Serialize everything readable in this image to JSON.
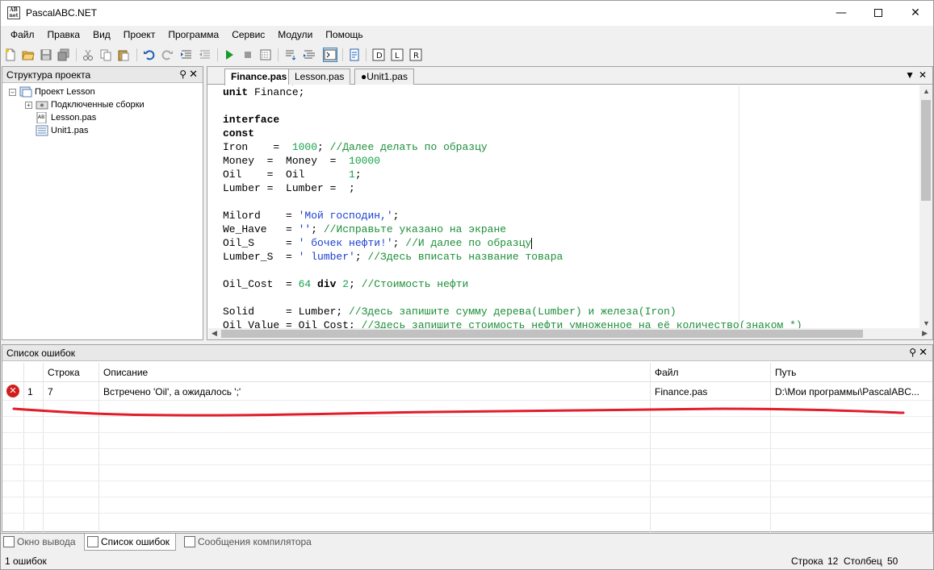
{
  "window": {
    "title": "PascalABC.NET",
    "icon_text": "AB net"
  },
  "menu": [
    "Файл",
    "Правка",
    "Вид",
    "Проект",
    "Программа",
    "Сервис",
    "Модули",
    "Помощь"
  ],
  "project_panel": {
    "title": "Структура проекта",
    "tree": [
      {
        "label": "Проект Lesson",
        "level": 0,
        "expanded": true
      },
      {
        "label": "Подключенные сборки",
        "level": 1,
        "expanded": false
      },
      {
        "label": "Lesson.pas",
        "level": 1
      },
      {
        "label": "Unit1.pas",
        "level": 1
      }
    ]
  },
  "editor": {
    "tabs": [
      {
        "label": "Finance.pas",
        "active": true
      },
      {
        "label": "Lesson.pas",
        "active": false
      },
      {
        "label": "●Unit1.pas",
        "active": false
      }
    ],
    "code_lines": [
      [
        [
          "kw",
          "unit"
        ],
        [
          "ident",
          " Finance;"
        ]
      ],
      [],
      [
        [
          "kw",
          "interface"
        ]
      ],
      [
        [
          "kw",
          "const"
        ]
      ],
      [
        [
          "ident",
          "Iron    =  "
        ],
        [
          "num",
          "1000"
        ],
        [
          "ident",
          "; "
        ],
        [
          "cmt",
          "//Далее делать по образцу"
        ]
      ],
      [
        [
          "ident",
          "Money  =  Money  =  "
        ],
        [
          "num",
          "10000"
        ]
      ],
      [
        [
          "ident",
          "Oil    =  Oil       "
        ],
        [
          "num",
          "1"
        ],
        [
          "ident",
          ";"
        ]
      ],
      [
        [
          "ident",
          "Lumber =  Lumber =  ;"
        ]
      ],
      [],
      [
        [
          "ident",
          "Milord    = "
        ],
        [
          "str",
          "'Мой господин,'"
        ],
        [
          "ident",
          ";"
        ]
      ],
      [
        [
          "ident",
          "We_Have   = "
        ],
        [
          "str",
          "''"
        ],
        [
          "ident",
          "; "
        ],
        [
          "cmt",
          "//Исправьте указано на экране"
        ]
      ],
      [
        [
          "ident",
          "Oil_S     = "
        ],
        [
          "str",
          "' бочек нефти!'"
        ],
        [
          "ident",
          "; "
        ],
        [
          "cmt",
          "//И далее по образцу"
        ],
        [
          "caret",
          ""
        ]
      ],
      [
        [
          "ident",
          "Lumber_S  = "
        ],
        [
          "str",
          "' lumber'"
        ],
        [
          "ident",
          "; "
        ],
        [
          "cmt",
          "//Здесь вписать название товара"
        ]
      ],
      [],
      [
        [
          "ident",
          "Oil_Cost  = "
        ],
        [
          "num",
          "64"
        ],
        [
          "ident",
          " "
        ],
        [
          "kw",
          "div"
        ],
        [
          "ident",
          " "
        ],
        [
          "num",
          "2"
        ],
        [
          "ident",
          "; "
        ],
        [
          "cmt",
          "//Стоимость нефти"
        ]
      ],
      [],
      [
        [
          "ident",
          "Solid     = Lumber; "
        ],
        [
          "cmt",
          "//Здесь запишите сумму дерева(Lumber) и железа(Iron)"
        ]
      ],
      [
        [
          "ident",
          "Oil_Value = Oil_Cost; "
        ],
        [
          "cmt",
          "//Здесь запишите стоимость нефти умноженное на её количество(знаком *)"
        ]
      ]
    ]
  },
  "error_panel": {
    "title": "Список ошибок",
    "columns": [
      "",
      "Строка",
      "Описание",
      "Файл",
      "Путь"
    ],
    "rows": [
      {
        "num": "1",
        "line": "7",
        "description": "Встречено 'Oil', а ожидалось ';'",
        "file": "Finance.pas",
        "path": "D:\\Мои программы\\PascalABC..."
      }
    ]
  },
  "bottom_tabs": [
    {
      "label": "Окно вывода",
      "active": false
    },
    {
      "label": "Список ошибок",
      "active": true
    },
    {
      "label": "Сообщения компилятора",
      "active": false
    }
  ],
  "status": {
    "errors": "1 ошибок",
    "row_label": "Строка",
    "row": "12",
    "col_label": "Столбец",
    "col": "50"
  },
  "colors": {
    "keyword": "#000000",
    "number": "#16a34a",
    "comment": "#1d8f3a",
    "string": "#1a3fd1",
    "annotation": "#e11d2a"
  },
  "toolbar_icons": [
    "new-file-icon",
    "open-icon",
    "save-icon",
    "save-all-icon",
    "cut-icon",
    "copy-icon",
    "paste-icon",
    "undo-icon",
    "redo-icon",
    "indent-icon",
    "outdent-icon",
    "run-icon",
    "stop-icon",
    "compile-icon",
    "step-into-icon",
    "step-over-icon",
    "console-icon",
    "form-icon",
    "debug-1-icon",
    "debug-2-icon",
    "debug-3-icon"
  ]
}
